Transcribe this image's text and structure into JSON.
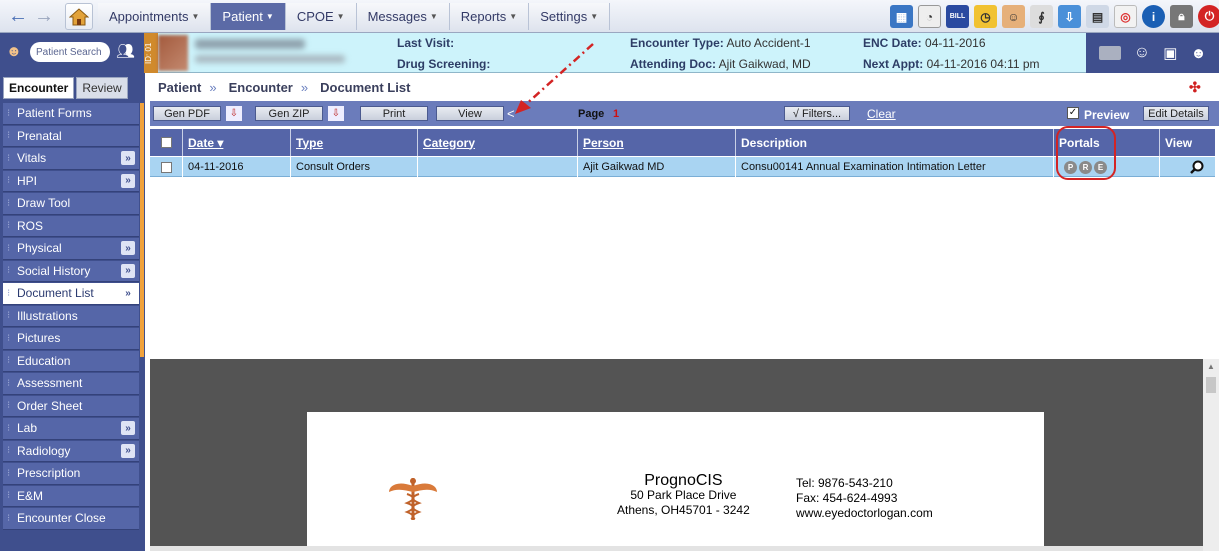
{
  "nav": {
    "menu": [
      {
        "label": "Appointments",
        "active": false
      },
      {
        "label": "Patient",
        "active": true
      },
      {
        "label": "CPOE",
        "active": false
      },
      {
        "label": "Messages",
        "active": false
      },
      {
        "label": "Reports",
        "active": false
      },
      {
        "label": "Settings",
        "active": false
      }
    ],
    "bill_icon_text": "BILL"
  },
  "patient_bar": {
    "search_placeholder": "Patient Search",
    "id_tab": "ID: 01",
    "last_visit_label": "Last Visit:",
    "last_visit_value": "",
    "drug_screening_label": "Drug Screening:",
    "drug_screening_value": "",
    "encounter_type_label": "Encounter Type:",
    "encounter_type_value": "Auto Accident-1",
    "attending_doc_label": "Attending Doc:",
    "attending_doc_value": "Ajit Gaikwad, MD",
    "enc_date_label": "ENC Date:",
    "enc_date_value": "04-11-2016",
    "next_appt_label": "Next Appt:",
    "next_appt_value": "04-11-2016 04:11 pm"
  },
  "sidebar": {
    "tabs": [
      {
        "label": "Encounter",
        "active": true
      },
      {
        "label": "Review",
        "active": false
      }
    ],
    "items": [
      {
        "label": "Patient Forms",
        "arrow": false
      },
      {
        "label": "Prenatal",
        "arrow": false
      },
      {
        "label": "Vitals",
        "arrow": true
      },
      {
        "label": "HPI",
        "arrow": true
      },
      {
        "label": "Draw Tool",
        "arrow": false
      },
      {
        "label": "ROS",
        "arrow": false
      },
      {
        "label": "Physical",
        "arrow": true
      },
      {
        "label": "Social History",
        "arrow": true
      },
      {
        "label": "Document List",
        "arrow": true,
        "active": true
      },
      {
        "label": "Illustrations",
        "arrow": false
      },
      {
        "label": "Pictures",
        "arrow": false
      },
      {
        "label": "Education",
        "arrow": false
      },
      {
        "label": "Assessment",
        "arrow": false
      },
      {
        "label": "Order Sheet",
        "arrow": false
      },
      {
        "label": "Lab",
        "arrow": true
      },
      {
        "label": "Radiology",
        "arrow": true
      },
      {
        "label": "Prescription",
        "arrow": false
      },
      {
        "label": "E&M",
        "arrow": false
      },
      {
        "label": "Encounter Close",
        "arrow": false
      }
    ],
    "arrow_glyph": "»"
  },
  "breadcrumb": {
    "items": [
      "Patient",
      "Encounter",
      "Document List"
    ],
    "sep": "»"
  },
  "toolbar": {
    "gen_pdf": "Gen PDF",
    "gen_zip": "Gen ZIP",
    "print": "Print",
    "view": "View",
    "page_label": "Page",
    "page_number": "1",
    "filters": "√ Filters...",
    "clear": "Clear",
    "preview": "Preview",
    "edit_details": "Edit Details"
  },
  "table": {
    "columns": [
      "Date ▾",
      "Type",
      "Category",
      "Person",
      "Description",
      "Portals",
      "View"
    ],
    "rows": [
      {
        "date": "04-11-2016",
        "type": "Consult Orders",
        "category": "",
        "person": "Ajit Gaikwad MD",
        "description": "Consu00141 Annual Examination Intimation Letter",
        "portals": [
          "P",
          "R",
          "E"
        ]
      }
    ]
  },
  "document": {
    "org": "PrognoCIS",
    "address1": "50 Park Place Drive",
    "address2": "Athens, OH45701 - 3242",
    "tel": "Tel: 9876-543-210",
    "fax": "Fax: 454-624-4993",
    "web": "www.eyedoctorlogan.com"
  },
  "colors": {
    "sidebar_bg": "#3f4f8d",
    "header_bg": "#5565a8",
    "selected_row": "#a9d4f2",
    "patient_bar": "#cdf3fb",
    "annotation_red": "#d32424"
  }
}
